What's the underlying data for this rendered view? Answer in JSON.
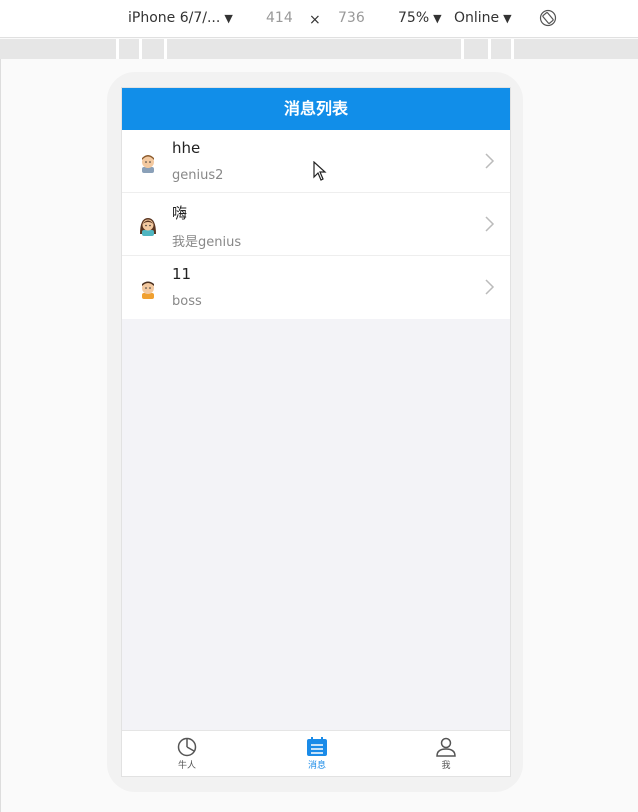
{
  "devtools": {
    "device": "iPhone 6/7/...",
    "width": "414",
    "times": "×",
    "height": "736",
    "zoom": "75%",
    "network": "Online"
  },
  "app": {
    "title": "消息列表",
    "messages": [
      {
        "name": "hhe",
        "subtitle": "genius2",
        "avatar": "man-avatar-icon"
      },
      {
        "name": "嗨",
        "subtitle": "我是genius",
        "avatar": "woman-avatar-icon"
      },
      {
        "name": "11",
        "subtitle": "boss",
        "avatar": "man-avatar-icon"
      }
    ],
    "tabs": [
      {
        "label": "牛人",
        "icon": "pie-chart-icon"
      },
      {
        "label": "消息",
        "icon": "message-list-icon",
        "active": true
      },
      {
        "label": "我",
        "icon": "user-icon"
      }
    ],
    "accent_color": "#118ee9"
  }
}
